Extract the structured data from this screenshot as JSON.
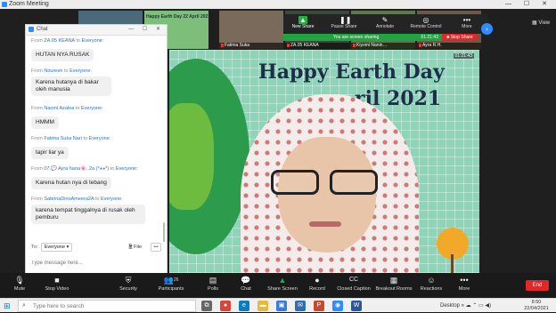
{
  "window": {
    "title": "Zoom Meeting",
    "controls": "— ☐ ✕"
  },
  "thumbnails": [
    {
      "name": "",
      "color": "#4a6a7a"
    },
    {
      "name": "Happy Earth Day 22 April 2021",
      "color": "#7dbf7a"
    },
    {
      "name": "Fatima Suka",
      "color": "#7a6a5a"
    },
    {
      "name": "ZA.05 KEANA",
      "color": "#3a4a3a"
    },
    {
      "name": "Kiyomi Nanin…",
      "color": "#5a7a4a"
    },
    {
      "name": "Ayra R.H.",
      "color": "#6a5a4a"
    }
  ],
  "share_toolbar": {
    "items": [
      {
        "label": "New Share",
        "icon": "▲"
      },
      {
        "label": "Pause Share",
        "icon": "❚❚"
      },
      {
        "label": "Annotate",
        "icon": "✎"
      },
      {
        "label": "Remote Control",
        "icon": "◎"
      },
      {
        "label": "More",
        "icon": "•••"
      }
    ],
    "sharing_text": "You are screen sharing",
    "timer": "01:21:43",
    "stop_label": "■ Stop Share"
  },
  "view_label": "▦ View",
  "main_video": {
    "timer": "01:21:43",
    "title": "Happy Earth Day",
    "subtitle": "ril 2021"
  },
  "chat": {
    "title": "Chat",
    "messages": [
      {
        "from": "ZA.05 KEANA",
        "to": "Everyone",
        "text": "HUTAN NYA RUSAK"
      },
      {
        "from": "Noureen",
        "to": "Everyone",
        "text": "Karena hutanya di bakar oleh manusia"
      },
      {
        "from": "Naomi Azalea",
        "to": "Everyone",
        "text": "HMMM"
      },
      {
        "from": "Fatima Suka Nari",
        "to": "Everyone",
        "text": "tapir liar ya"
      },
      {
        "from": "07.💬 Ayra hana🌸..2a (*◕◕*)",
        "to": "Everyone",
        "text": "Karena hutan nya di tebang"
      },
      {
        "from": "SabrinaDinoAmeera2A",
        "to": "Everyone",
        "text": "karena tempat tinggalnya di rusak oleh pemburu"
      }
    ],
    "from_label": "From",
    "to_label": "to",
    "to_prefix": "To:",
    "to_value": "Everyone ▾",
    "file_label": "🗎 File",
    "more_label": "•••",
    "input_placeholder": "Type message here..."
  },
  "bottom_bar": {
    "items": [
      {
        "label": "Mute",
        "icon": "🎙"
      },
      {
        "label": "Stop Video",
        "icon": "■"
      },
      {
        "label": "Security",
        "icon": "⛨"
      },
      {
        "label": "Participants",
        "icon": "👥",
        "count": "26"
      },
      {
        "label": "Polls",
        "icon": "▤"
      },
      {
        "label": "Chat",
        "icon": "💬"
      },
      {
        "label": "Share Screen",
        "icon": "▲"
      },
      {
        "label": "Record",
        "icon": "●"
      },
      {
        "label": "Closed Caption",
        "icon": "CC"
      },
      {
        "label": "Breakout Rooms",
        "icon": "▦"
      },
      {
        "label": "Reactions",
        "icon": "☺"
      },
      {
        "label": "More",
        "icon": "•••"
      }
    ],
    "end_label": "End"
  },
  "taskbar": {
    "search_placeholder": "Type here to search",
    "apps": [
      {
        "name": "task-view-icon",
        "glyph": "⧉",
        "color": "#666"
      },
      {
        "name": "chrome-icon",
        "glyph": "●",
        "color": "#db4437"
      },
      {
        "name": "edge-icon",
        "glyph": "e",
        "color": "#0a7cc2"
      },
      {
        "name": "file-explorer-icon",
        "glyph": "▬",
        "color": "#e8b83a"
      },
      {
        "name": "store-icon",
        "glyph": "▣",
        "color": "#3a7bd5"
      },
      {
        "name": "mail-icon",
        "glyph": "✉",
        "color": "#2f6fb0"
      },
      {
        "name": "powerpoint-icon",
        "glyph": "P",
        "color": "#c94a2a"
      },
      {
        "name": "zoom-icon",
        "glyph": "◉",
        "color": "#2d8cff"
      },
      {
        "name": "word-icon",
        "glyph": "W",
        "color": "#2b579a"
      }
    ],
    "tray_text": "Desktop  »  ☁ ⌃ ▭ ◀)",
    "time": "8:50",
    "date": "22/04/2021"
  }
}
